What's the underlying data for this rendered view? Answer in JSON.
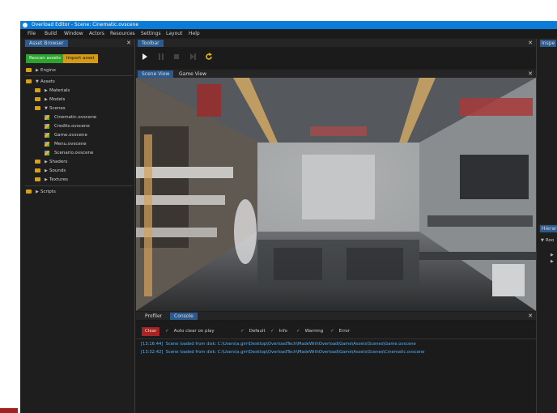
{
  "window": {
    "title": "Overload Editor - Scene: Cinematic.ovscene"
  },
  "menu": [
    "File",
    "Build",
    "Window",
    "Actors",
    "Resources",
    "Settings",
    "Layout",
    "Help"
  ],
  "asset_browser": {
    "title": "Asset Browser",
    "rescan_label": "Rescan assets",
    "import_label": "Import asset",
    "engine_label": "Engine",
    "assets_label": "Assets",
    "materials_label": "Materials",
    "models_label": "Models",
    "scenes_label": "Scenes",
    "scenes": [
      "Cinematic.ovscene",
      "Credits.ovscene",
      "Game.ovscene",
      "Menu.ovscene",
      "Scenario.ovscene"
    ],
    "shaders_label": "Shaders",
    "sounds_label": "Sounds",
    "textures_label": "Textures",
    "scripts_label": "Scripts"
  },
  "toolbar": {
    "title": "Toolbar"
  },
  "viewport": {
    "scene_tab": "Scene View",
    "game_tab": "Game View"
  },
  "console": {
    "profiler_tab": "Profiler",
    "console_tab": "Console",
    "clear_label": "Clear",
    "auto_clear_label": "Auto clear on play",
    "default_label": "Default",
    "info_label": "Info",
    "warning_label": "Warning",
    "error_label": "Error",
    "logs": [
      {
        "time": "[13:16:44]",
        "msg": "Scene loaded from disk: C:\\Users\\a.girr\\Desktop\\OverloadTech\\MadeWithOverload\\Game\\Assets\\Scenes\\Game.ovscene"
      },
      {
        "time": "[13:32:42]",
        "msg": "Scene loaded from disk: C:\\Users\\a.girr\\Desktop\\OverloadTech\\MadeWithOverload\\Game\\Assets\\Scenes\\Cinematic.ovscene"
      }
    ]
  },
  "inspector": {
    "title": "Inspe"
  },
  "hierarchy": {
    "title": "Hierar",
    "root": "Roo"
  },
  "colors": {
    "accent": "#0a7bd9",
    "tab_active": "#2d5a8e",
    "rescan": "#2fa32f",
    "import": "#d49b18",
    "clear": "#a52424",
    "log": "#4fb3ff",
    "folder": "#d8a018"
  }
}
